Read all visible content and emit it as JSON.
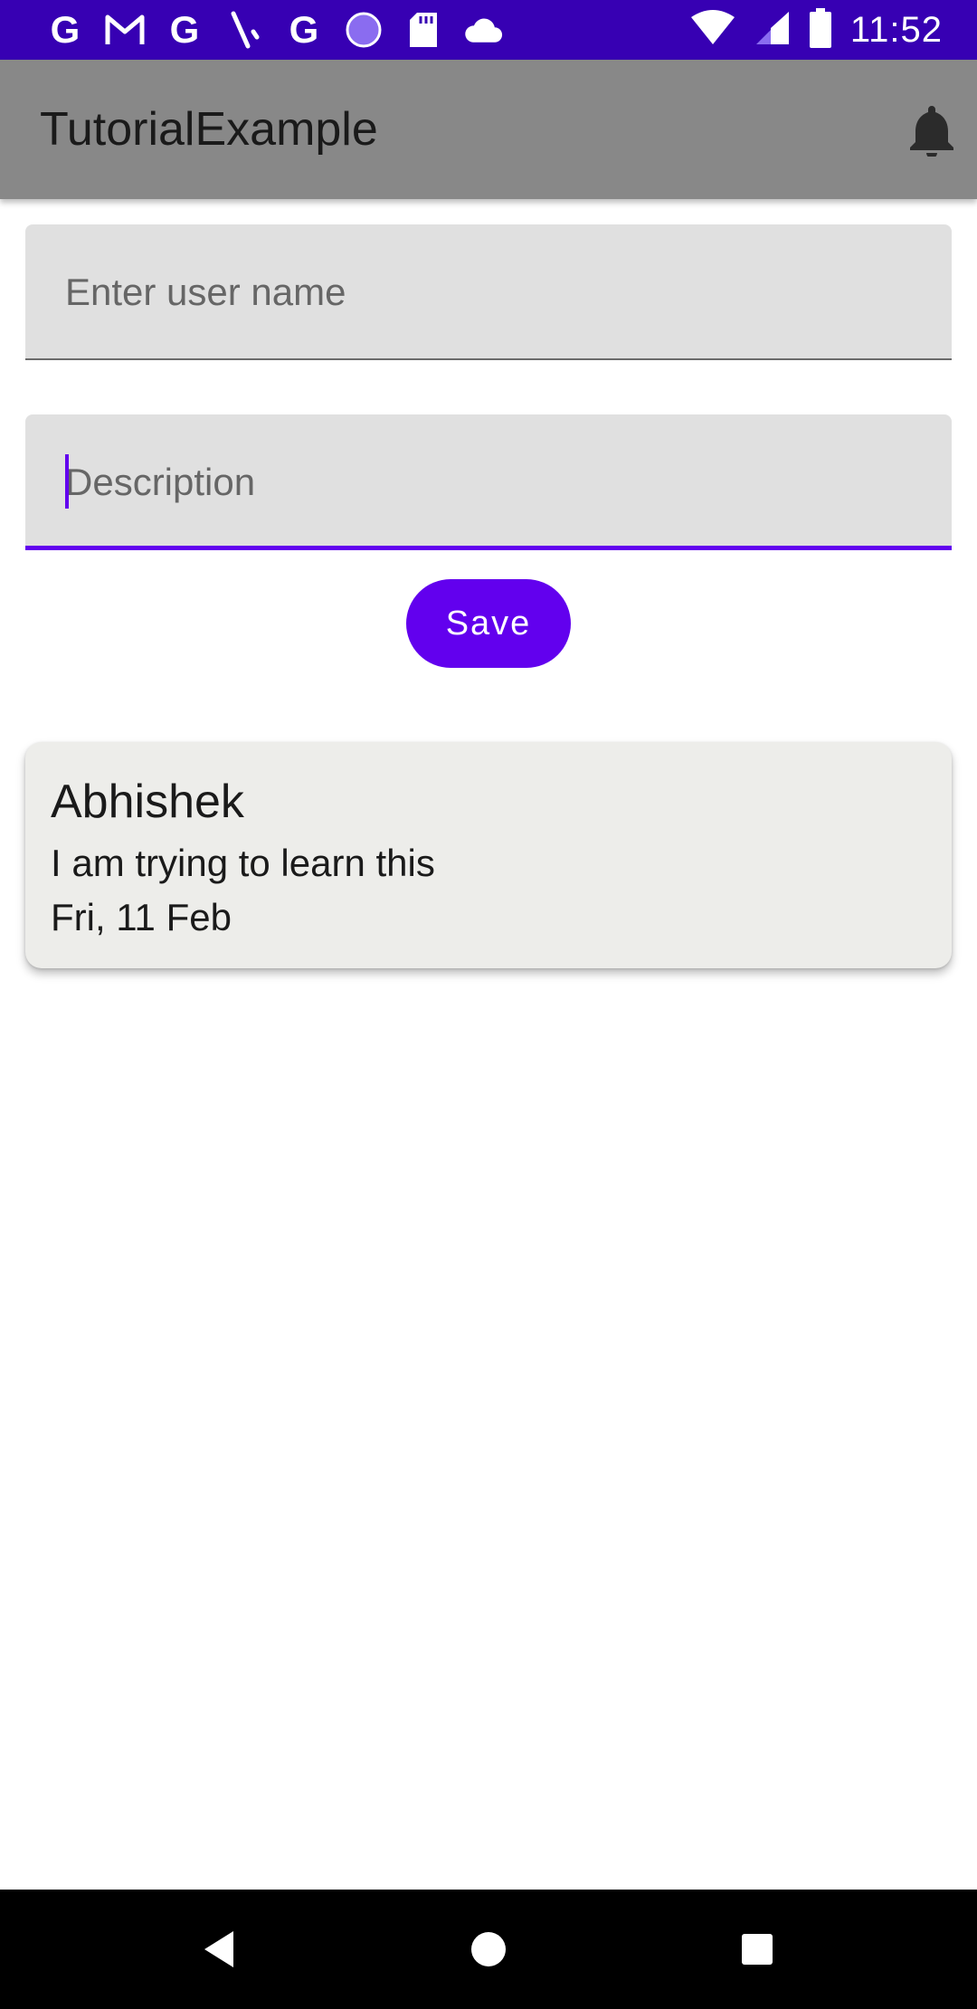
{
  "status_bar": {
    "time": "11:52",
    "notification_icons": [
      "G",
      "M",
      "G",
      "\\",
      "G"
    ],
    "color": "#3700b3"
  },
  "app_bar": {
    "title": "TutorialExample",
    "action_icon": "bell-icon",
    "color": "#888888"
  },
  "form": {
    "username": {
      "placeholder": "Enter user name",
      "value": ""
    },
    "description": {
      "placeholder": "Description",
      "value": ""
    },
    "save_label": "Save",
    "accent": "#6200ee"
  },
  "entries": [
    {
      "name": "Abhishek",
      "description": "I am trying to learn this",
      "date": "Fri, 11 Feb"
    }
  ],
  "nav_bar": {
    "icons": [
      "back-icon",
      "home-icon",
      "recents-icon"
    ]
  }
}
